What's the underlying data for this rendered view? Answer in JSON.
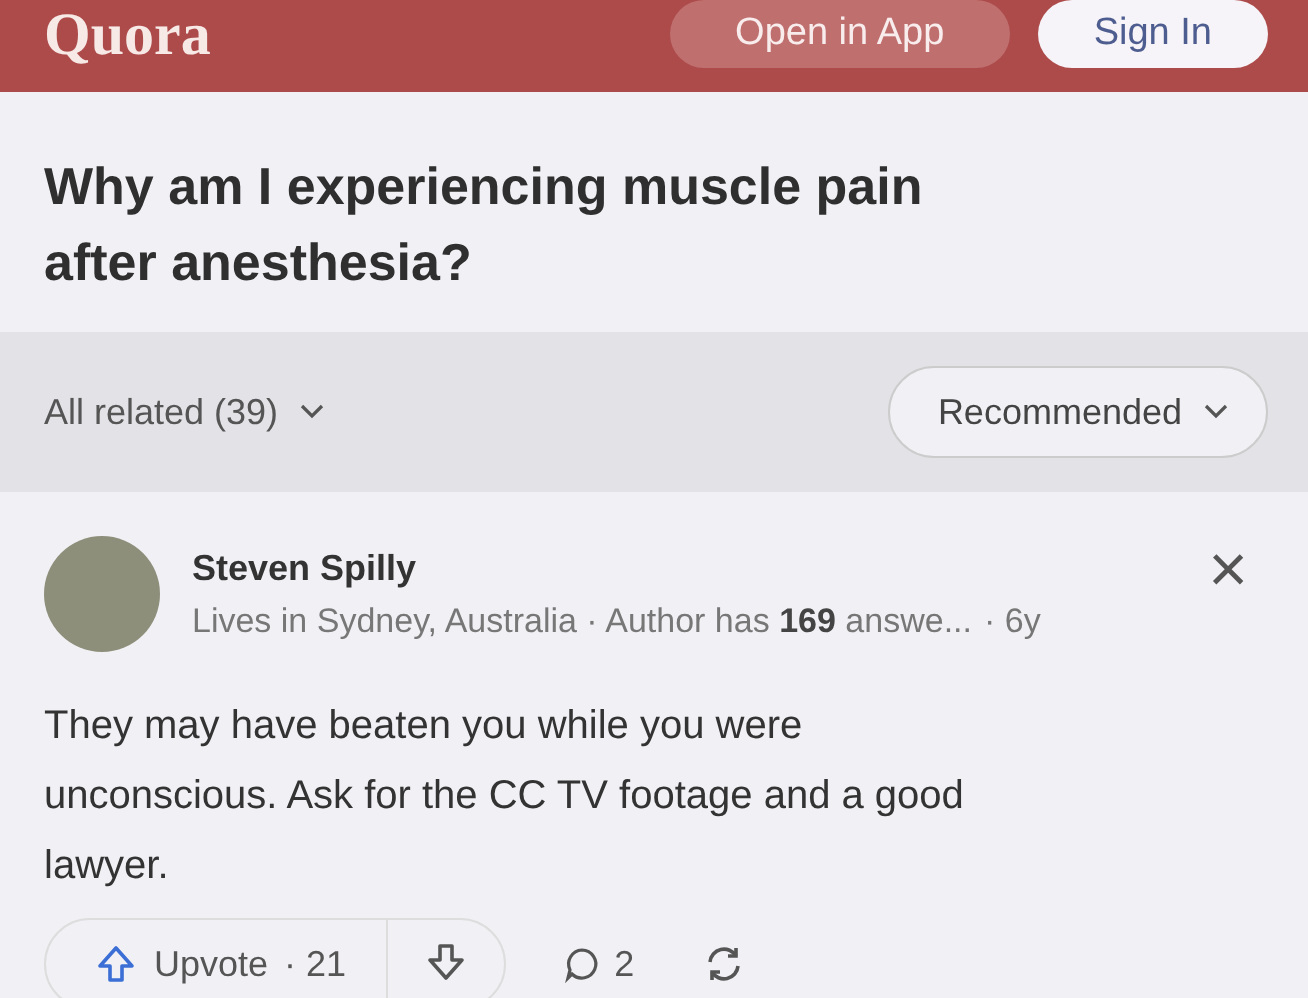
{
  "header": {
    "logo": "Quora",
    "buttons": [
      {
        "label": "Open in App",
        "kind": "secondary"
      },
      {
        "label": "Sign In",
        "kind": "primary"
      }
    ]
  },
  "question": {
    "title": "Why am I experiencing muscle pain after anesthesia?"
  },
  "filters": {
    "related": "All related (39)",
    "sort": "Recommended"
  },
  "answer": {
    "author": "Steven Spilly",
    "meta": "Lives in Sydney, Australia · Author has **169** answe...",
    "age": "· 6y",
    "close": "×",
    "text": "They may have beaten you while you were unconscious. Ask for the CC TV footage and a good lawyer.",
    "actions": {
      "upvote": "Upvote",
      "upvote_count": "· 21",
      "comments": "2"
    }
  }
}
